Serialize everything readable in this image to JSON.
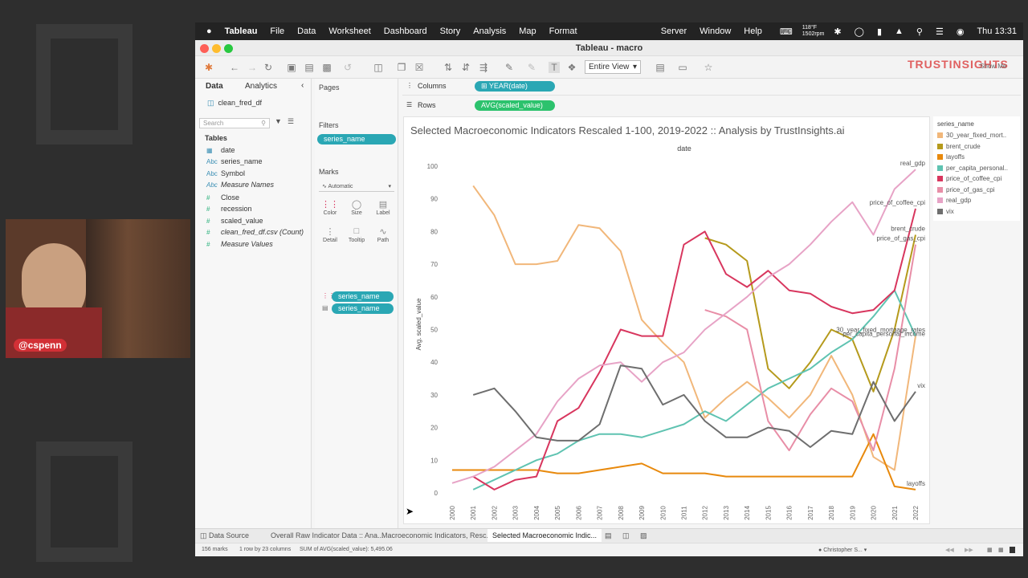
{
  "menubar": {
    "app": "Tableau",
    "items": [
      "File",
      "Data",
      "Worksheet",
      "Dashboard",
      "Story",
      "Analysis",
      "Map",
      "Format"
    ],
    "right_items": [
      "Server",
      "Window",
      "Help"
    ],
    "weather_temp": "118°F",
    "weather_time": "1502rpm",
    "clock": "Thu 13:31"
  },
  "window": {
    "title": "Tableau - macro"
  },
  "toolbar": {
    "view_mode": "Entire View",
    "show_me": "Show Me"
  },
  "brand": {
    "logo_text": "TRUSTINSIGHTS"
  },
  "data_pane": {
    "tab_data": "Data",
    "tab_analytics": "Analytics",
    "datasource": "clean_fred_df",
    "search_placeholder": "Search",
    "tables_header": "Tables",
    "fields": [
      {
        "type": "date",
        "name": "date"
      },
      {
        "type": "Abc",
        "name": "series_name"
      },
      {
        "type": "Abc",
        "name": "Symbol"
      },
      {
        "type": "Abc",
        "name": "Measure Names"
      },
      {
        "type": "#",
        "name": "Close"
      },
      {
        "type": "#",
        "name": "recession"
      },
      {
        "type": "#",
        "name": "scaled_value"
      },
      {
        "type": "#",
        "name": "clean_fred_df.csv (Count)"
      },
      {
        "type": "#",
        "name": "Measure Values"
      }
    ]
  },
  "cards": {
    "pages": "Pages",
    "filters": "Filters",
    "filter_pill": "series_name",
    "marks": "Marks",
    "mark_type": "Automatic",
    "mark_buttons": [
      "Color",
      "Size",
      "Label",
      "Detail",
      "Tooltip",
      "Path"
    ],
    "mark_pills": [
      "series_name",
      "series_name"
    ]
  },
  "shelves": {
    "columns_label": "Columns",
    "columns_pill": "YEAR(date)",
    "rows_label": "Rows",
    "rows_pill": "AVG(scaled_value)"
  },
  "chart_data": {
    "type": "line",
    "title": "Selected Macroeconomic Indicators Rescaled 1-100, 2019-2022  :: Analysis by TrustInsights.ai",
    "xlabel": "date",
    "ylabel": "Avg. scaled_value",
    "ylim": [
      0,
      100
    ],
    "yticks": [
      0,
      10,
      20,
      30,
      40,
      50,
      60,
      70,
      80,
      90,
      100
    ],
    "x": [
      2000,
      2001,
      2002,
      2003,
      2004,
      2005,
      2006,
      2007,
      2008,
      2009,
      2010,
      2011,
      2012,
      2013,
      2014,
      2015,
      2016,
      2017,
      2018,
      2019,
      2020,
      2021,
      2022
    ],
    "grid": false,
    "legend": "right",
    "legend_title": "series_name",
    "series": [
      {
        "name": "30_year_fixed_mortgage_rates",
        "color": "#f1b77a",
        "values": [
          null,
          94,
          85,
          70,
          70,
          71,
          82,
          81,
          74,
          53,
          46,
          40,
          23,
          29,
          34,
          29,
          23,
          30,
          42,
          30,
          11,
          7,
          48
        ]
      },
      {
        "name": "brent_crude",
        "color": "#b59a1c",
        "values": [
          null,
          null,
          null,
          null,
          null,
          null,
          null,
          null,
          null,
          null,
          null,
          null,
          78,
          76,
          71,
          38,
          32,
          40,
          50,
          47,
          31,
          50,
          79
        ]
      },
      {
        "name": "layoffs",
        "color": "#e8890c",
        "values": [
          7,
          7,
          7,
          7,
          7,
          6,
          6,
          7,
          8,
          9,
          6,
          6,
          6,
          5,
          5,
          5,
          5,
          5,
          5,
          5,
          18,
          2,
          1
        ]
      },
      {
        "name": "per_capita_personal_income",
        "color": "#5fc3b1",
        "values": [
          null,
          1,
          4,
          7,
          10,
          12,
          16,
          18,
          18,
          17,
          19,
          21,
          25,
          22,
          27,
          32,
          35,
          38,
          43,
          47,
          54,
          62,
          48
        ]
      },
      {
        "name": "price_of_coffee_cpi",
        "color": "#d8365e",
        "values": [
          null,
          5,
          1,
          4,
          5,
          22,
          26,
          37,
          50,
          48,
          48,
          76,
          80,
          67,
          63,
          68,
          62,
          61,
          57,
          55,
          56,
          62,
          87
        ]
      },
      {
        "name": "price_of_gas_cpi",
        "color": "#e88ea7",
        "values": [
          null,
          null,
          null,
          null,
          null,
          null,
          null,
          null,
          null,
          null,
          null,
          null,
          56,
          54,
          50,
          22,
          13,
          24,
          32,
          28,
          13,
          38,
          76
        ]
      },
      {
        "name": "real_gdp",
        "color": "#e7a3c6",
        "values": [
          3,
          5,
          8,
          13,
          18,
          28,
          35,
          39,
          40,
          34,
          40,
          43,
          50,
          55,
          60,
          66,
          70,
          76,
          83,
          89,
          79,
          93,
          99
        ]
      },
      {
        "name": "vix",
        "color": "#6e6e6e",
        "values": [
          null,
          30,
          32,
          25,
          17,
          16,
          16,
          21,
          39,
          38,
          27,
          30,
          22,
          17,
          17,
          20,
          19,
          14,
          19,
          18,
          34,
          22,
          31
        ]
      }
    ],
    "end_labels": [
      {
        "text": "real_gdp",
        "series": "real_gdp"
      },
      {
        "text": "price_of_coffee_cpi",
        "series": "price_of_coffee_cpi"
      },
      {
        "text": "brent_crude",
        "series": "brent_crude"
      },
      {
        "text": "price_of_gas_cpi",
        "series": "price_of_gas_cpi"
      },
      {
        "text": "30_year_fixed_mortgage_rates",
        "series": "30_year_fixed_mortgage_rates"
      },
      {
        "text": "per_capita_personal_income",
        "series": "per_capita_personal_income"
      },
      {
        "text": "vix",
        "series": "vix"
      },
      {
        "text": "layoffs",
        "series": "layoffs"
      }
    ]
  },
  "legend": {
    "title": "series_name",
    "items": [
      {
        "label": "30_year_fixed_mort..",
        "color": "#f1b77a"
      },
      {
        "label": "brent_crude",
        "color": "#b59a1c"
      },
      {
        "label": "layoffs",
        "color": "#e8890c"
      },
      {
        "label": "per_capita_personal..",
        "color": "#5fc3b1"
      },
      {
        "label": "price_of_coffee_cpi",
        "color": "#d8365e"
      },
      {
        "label": "price_of_gas_cpi",
        "color": "#e88ea7"
      },
      {
        "label": "real_gdp",
        "color": "#e7a3c6"
      },
      {
        "label": "vix",
        "color": "#6e6e6e"
      }
    ]
  },
  "sheet_tabs": {
    "data_source": "Data Source",
    "tabs": [
      "Overall Raw Indicator Data :: Ana...",
      "Macroeconomic Indicators, Resc...",
      "Selected Macroeconomic Indic..."
    ]
  },
  "status": {
    "marks": "156 marks",
    "rows_cols": "1 row by 23 columns",
    "sum": "SUM of AVG(scaled_value): 5,495.06",
    "user": "Christopher S..."
  },
  "webcam": {
    "handle": "@cspenn"
  }
}
